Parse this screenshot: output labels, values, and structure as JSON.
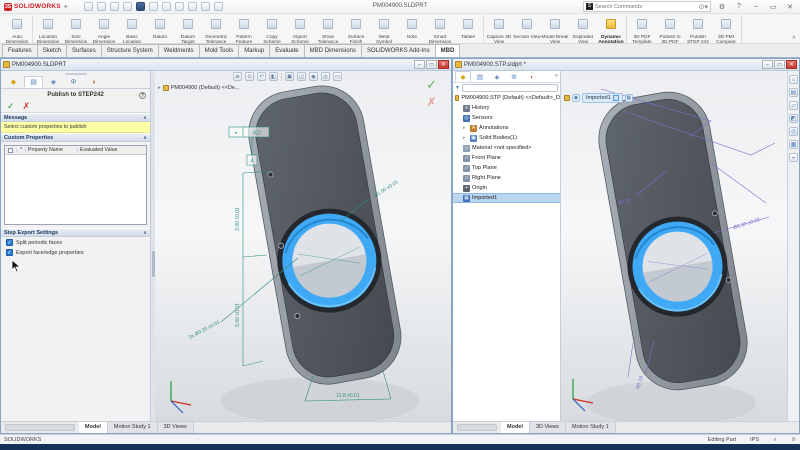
{
  "app": {
    "brand": "SOLIDWORKS",
    "window_title": "PM004900.SLDPRT",
    "search_placeholder": "Search Commands",
    "status": {
      "left": "SOLIDWORKS",
      "editing": "Editing Part",
      "units": "IPS"
    }
  },
  "icons": {
    "flyout": "▸",
    "search": "⊙",
    "search_logo": "S",
    "gear": "⚙",
    "help": "?",
    "minimize": "–",
    "restore": "▭",
    "close": "✕",
    "ok_check": "✓",
    "cancel_x": "✗",
    "section_collapse": "∧",
    "ribbon_collapse": "∧",
    "expand_arrow": "▸",
    "overflow": "»",
    "filter": "▼",
    "dropdown": "▾",
    "home": "⌂",
    "library": "▤",
    "folder": "▱",
    "appearance": "◩",
    "palette": "◎",
    "props": "▦",
    "forum": "◒",
    "status_caret": "∧",
    "eye": "◉"
  },
  "ribbon": {
    "groups": [
      {
        "buttons": [
          {
            "label": "Auto Dimension Scheme"
          }
        ]
      },
      {
        "buttons": [
          {
            "label": "Location Dimension"
          },
          {
            "label": "Size Dimension"
          },
          {
            "label": "Angle Dimension"
          },
          {
            "label": "Basic Location Dimension"
          },
          {
            "label": "Datum"
          },
          {
            "label": "Datum Target"
          },
          {
            "label": "Geometric Tolerance"
          },
          {
            "label": "Pattern Feature"
          },
          {
            "label": "Copy Scheme"
          },
          {
            "label": "Import Scheme"
          },
          {
            "label": "Show Tolerance Status"
          },
          {
            "label": "Surface Finish"
          },
          {
            "label": "Weld Symbol"
          },
          {
            "label": "Note"
          },
          {
            "label": "Smart Dimension"
          },
          {
            "label": "Tables"
          }
        ]
      },
      {
        "buttons": [
          {
            "label": "Capture 3D View"
          },
          {
            "label": "Section View"
          },
          {
            "label": "Model Break View"
          },
          {
            "label": "Exploded View"
          },
          {
            "label": "Dynamic Annotation Views",
            "active": true
          }
        ]
      },
      {
        "buttons": [
          {
            "label": "3D PDF Template Editor"
          },
          {
            "label": "Publish to 3D PDF"
          },
          {
            "label": "Publish STEP 242 File"
          },
          {
            "label": "3D PMI Compare"
          }
        ]
      }
    ]
  },
  "command_tabs": {
    "items": [
      "Features",
      "Sketch",
      "Surfaces",
      "Structure System",
      "Weldments",
      "Mold Tools",
      "Markup",
      "Evaluate",
      "MBD Dimensions",
      "SOLIDWORKS Add-Ins",
      "MBD"
    ],
    "active": "MBD"
  },
  "left_window": {
    "title": "PM004900.SLDPRT",
    "property_manager": {
      "title": "Publish to STEP242",
      "sections": {
        "message": "Message",
        "custom_properties": "Custom Properties",
        "step_settings": "Step Export Settings"
      },
      "message_text": "Select custom properties to publish",
      "table": {
        "col_star": "*",
        "columns": [
          "Property Name",
          "Evaluated Value"
        ]
      },
      "options": [
        {
          "label": "Split periodic faces",
          "checked": true
        },
        {
          "label": "Export face/edge properties",
          "checked": true
        }
      ]
    },
    "viewport": {
      "tree_label": "PM004900 (Default) <<De...",
      "annotations": {
        "datum": "A",
        "fcf_symbol": "⌖",
        "fcf_value": ".002",
        "dims": [
          "3.00 ±0.01",
          "5.00 ±0.01",
          "Ø1.50 ±0.01",
          "3x Ø0.20 ±0.01",
          "11.8 ±0.01"
        ]
      }
    },
    "doc_tabs": {
      "items": [
        "Model",
        "Motion Study 1",
        "3D Views"
      ],
      "active": "Model"
    }
  },
  "right_window": {
    "title": "PM004900.STP.sldprt *",
    "tree": {
      "root": "PM004900.STP (Default) <<Default>_D",
      "items": [
        "History",
        "Sensors",
        "Annotations",
        "Solid Bodies(1)",
        "Material <not specified>",
        "Front Plane",
        "Top Plane",
        "Right Plane",
        "Origin",
        "Imported1"
      ],
      "selected": "Imported1"
    },
    "viewport": {
      "context_label": "Imported1",
      "dims": [
        "R0.20",
        "Ø2.30 ±0.03",
        "R0.18"
      ]
    },
    "doc_tabs": {
      "items": [
        "Model",
        "3D Views",
        "Motion Study 1"
      ],
      "active": "Model"
    }
  },
  "colors": {
    "brand_red": "#cf2029",
    "accent_blue": "#2b7cd3",
    "selection_blue": "#3fa9f5",
    "dim_green": "#2f8f78",
    "dim_purple": "#7b6fd0",
    "message_yellow": "#ffffa6",
    "status_navy": "#15325b",
    "active_icon_yellow": "#f5c63c"
  }
}
